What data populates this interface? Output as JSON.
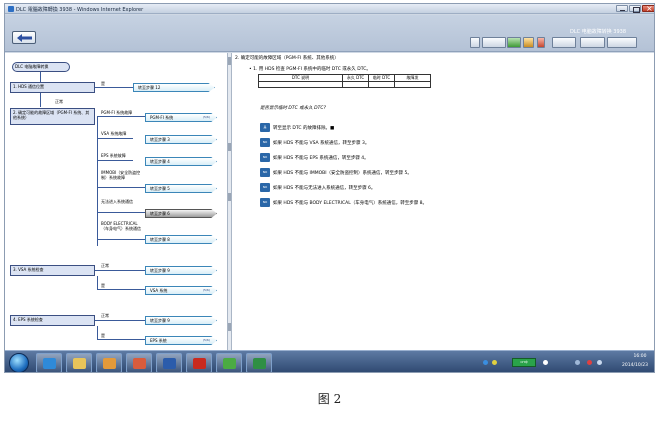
{
  "window": {
    "title": "DLC 電腦故障轉換 3938 - Windows Internet Explorer"
  },
  "toolbar": {
    "app_title": "DLC 电脑故障转换 3938"
  },
  "flow": {
    "start": "DLC 电脑故障转换",
    "step1": "1. HDS 通信位置",
    "step1_yes": "是",
    "step1_target": "转至步骤 12",
    "step1_no": "正常",
    "step2": "2. 确定可能的故障区域（PGM-FI 系统、其他系统）",
    "branches": [
      {
        "label": "PGM-FI 系统故障",
        "target": "PGM-FI 系统",
        "tag": "(5/6)"
      },
      {
        "label": "VSA 系统故障",
        "target": "转至步骤 3",
        "tag": ""
      },
      {
        "label": "EPS 系统故障",
        "target": "转至步骤 4",
        "tag": ""
      },
      {
        "label": "IMMOBI（安全防盗控制）系统故障",
        "target": "转至步骤 5",
        "tag": ""
      },
      {
        "label": "无法进入系统通信",
        "target": "转至步骤 6",
        "tag": ""
      },
      {
        "label": "BODY ELECTRICAL（车身电气）系统通信",
        "target": "转至步骤 8",
        "tag": ""
      }
    ],
    "step3": "3. VSA 系统检查",
    "step3_normal": "正常",
    "step3_normal_target": "转至步骤 9",
    "step3_yes": "是",
    "step3_yes_target": "VSA 系统",
    "step3_tag": "(5/6)",
    "step4": "4. EPS 系统检查",
    "step4_normal": "正常",
    "step4_normal_target": "转至步骤 9",
    "step4_yes": "是",
    "step4_yes_target": "EPS 系统",
    "step4_tag": "(5/6)"
  },
  "right": {
    "heading": "2. 确定可能的故障区域（PGM-FI 系统、其他系统）",
    "sub1": "• 1. 用 HDS 检查 PGM-FI 系统中的临时 DTC 或永久 DTC。",
    "table_headers": [
      "DTC 说明",
      "永久 DTC",
      "临时 DTC",
      "故障发"
    ],
    "question": "是否显示临时 DTC 或永久 DTC?",
    "options": [
      {
        "icon": "是",
        "text": "转至显示 DTC 的故障排除。■"
      },
      {
        "icon": "NO",
        "text": "如果 HDS 不能与 VSA 系统通信，转至步骤 3。"
      },
      {
        "icon": "NO",
        "text": "如果 HDS 不能与 EPS 系统通信，转至步骤 4。"
      },
      {
        "icon": "NO",
        "text": "如果 HDS 不能与 IMMOBI（安全防盗控制）系统通信，转至步骤 5。"
      },
      {
        "icon": "NO",
        "text": "如果 HDS 不能与无法进入系统通信，转至步骤 6。"
      },
      {
        "icon": "NO",
        "text": "如果 HDS 不能与 BODY ELECTRICAL（车身电气）系统通信，转至步骤 8。"
      }
    ]
  },
  "taskbar": {
    "tray_label": "CH中 ",
    "time": "16:00",
    "date": "2014/10/23"
  },
  "caption": "图 2",
  "colors": {
    "accent": "#2a67a8",
    "flow_border": "#3b4f82",
    "arrow_border": "#3b86b8"
  }
}
